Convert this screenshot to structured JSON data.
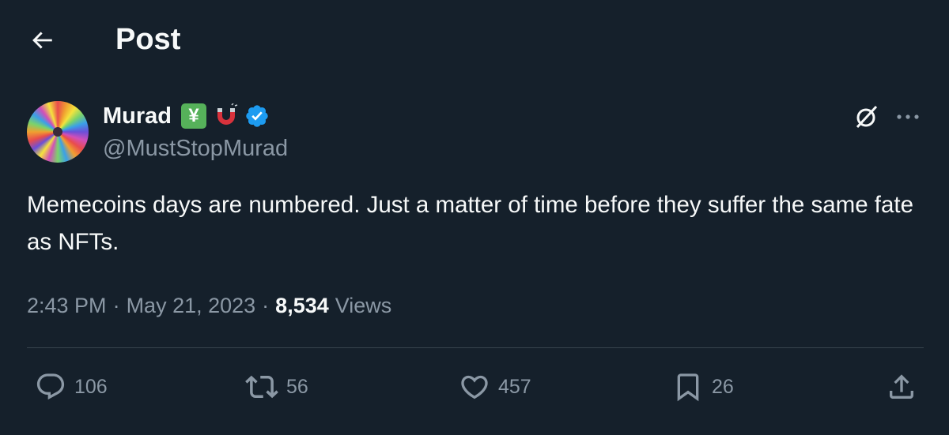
{
  "header": {
    "title": "Post"
  },
  "author": {
    "display_name": "Murad",
    "emoji_1": "¥",
    "handle": "@MustStopMurad",
    "verified": true
  },
  "tweet": {
    "text": "Memecoins days are numbered. Just a matter of time before they suffer the same fate as NFTs."
  },
  "meta": {
    "time": "2:43 PM",
    "separator": "·",
    "date": "May 21, 2023",
    "views_count": "8,534",
    "views_label": "Views"
  },
  "actions": {
    "replies": "106",
    "reposts": "56",
    "likes": "457",
    "bookmarks": "26"
  },
  "colors": {
    "background": "#15202b",
    "text_primary": "#f7f9f9",
    "text_secondary": "#8b98a5",
    "verified_blue": "#1d9bf0",
    "divider": "#38444d"
  },
  "icons": {
    "back": "arrow-left-icon",
    "grok": "grok-icon",
    "more": "more-dots-icon",
    "reply": "reply-bubble-icon",
    "repost": "repost-icon",
    "like": "heart-icon",
    "bookmark": "bookmark-icon",
    "share": "share-icon"
  }
}
